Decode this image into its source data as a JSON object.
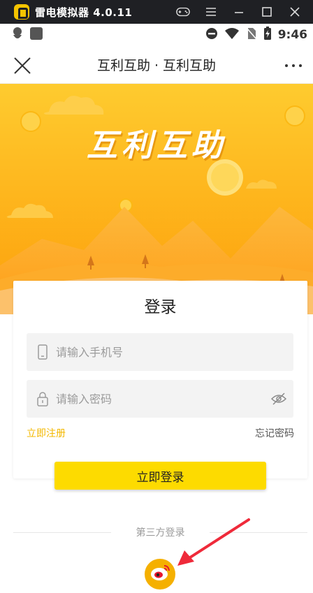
{
  "emulator": {
    "title": "雷电模拟器 4.0.11"
  },
  "status_bar": {
    "time": "9:46"
  },
  "header": {
    "title": "互利互助 · 互利互助"
  },
  "hero": {
    "title": "互利互助"
  },
  "login": {
    "title": "登录",
    "phone_placeholder": "请输入手机号",
    "password_placeholder": "请输入密码",
    "register_label": "立即注册",
    "forgot_label": "忘记密码",
    "submit_label": "立即登录"
  },
  "third_party": {
    "label": "第三方登录",
    "providers": [
      "weibo"
    ]
  },
  "colors": {
    "accent_yellow": "#fddb00",
    "hero_orange": "#fdae0e",
    "link_yellow": "#f3b800"
  },
  "icons": [
    "close-icon",
    "more-icon",
    "phone-icon",
    "lock-icon",
    "eye-icon",
    "weibo-icon",
    "gamepad-icon",
    "menu-icon",
    "minimize-icon",
    "maximize-icon",
    "window-close-icon"
  ]
}
